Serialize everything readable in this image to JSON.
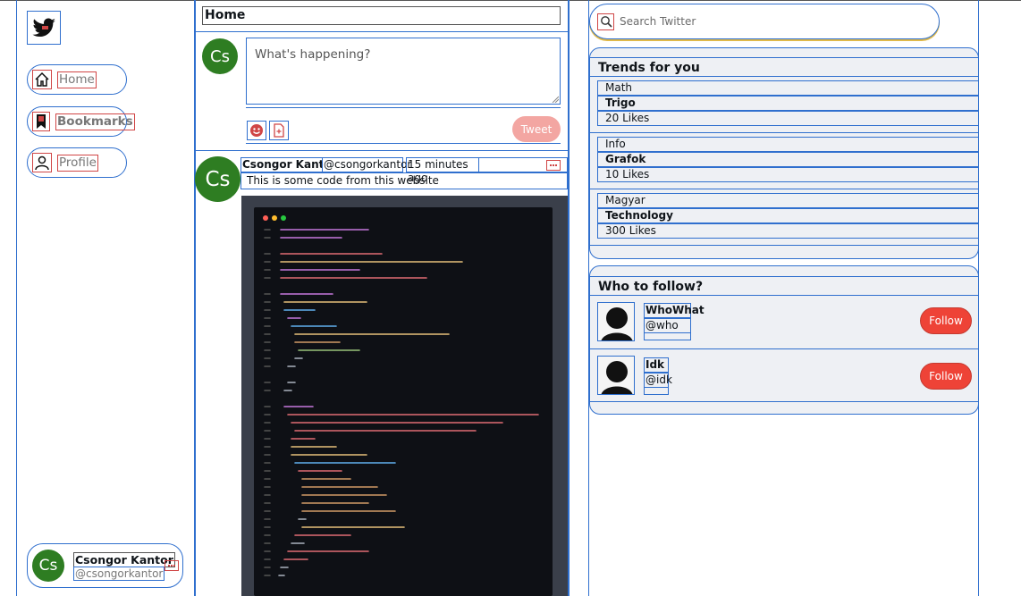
{
  "sidebar": {
    "nav": [
      {
        "label": "Home",
        "icon": "home-icon"
      },
      {
        "label": "Bookmarks",
        "icon": "bookmark-icon"
      },
      {
        "label": "Profile",
        "icon": "user-icon"
      }
    ],
    "profile": {
      "initials": "Cs",
      "name": "Csongor Kantor",
      "handle": "@csongorkantor"
    }
  },
  "feed": {
    "title": "Home",
    "composer": {
      "avatar": "Cs",
      "placeholder": "What's happening?",
      "tweet_label": "Tweet"
    },
    "post": {
      "avatar": "Cs",
      "name": "Csongor Kantor",
      "handle": "@csongorkantor",
      "time": "15 minutes ago",
      "text": "This is some code from this website"
    }
  },
  "right": {
    "search_placeholder": "Search Twitter",
    "trends": {
      "title": "Trends for you",
      "items": [
        {
          "category": "Math",
          "topic": "Trigo",
          "likes": "20 Likes"
        },
        {
          "category": "Info",
          "topic": "Grafok",
          "likes": "10 Likes"
        },
        {
          "category": "Magyar",
          "topic": "Technology",
          "likes": "300 Likes"
        }
      ]
    },
    "follow": {
      "title": "Who to follow?",
      "button_label": "Follow",
      "users": [
        {
          "name": "WhoWhat",
          "handle": "@who"
        },
        {
          "name": "Idk",
          "handle": "@idk"
        }
      ]
    }
  },
  "colors": {
    "accent_border": "#2f6fce",
    "follow": "#ee4337",
    "tweet_disabled": "#f3a6a2",
    "avatar": "#2e7d22"
  }
}
